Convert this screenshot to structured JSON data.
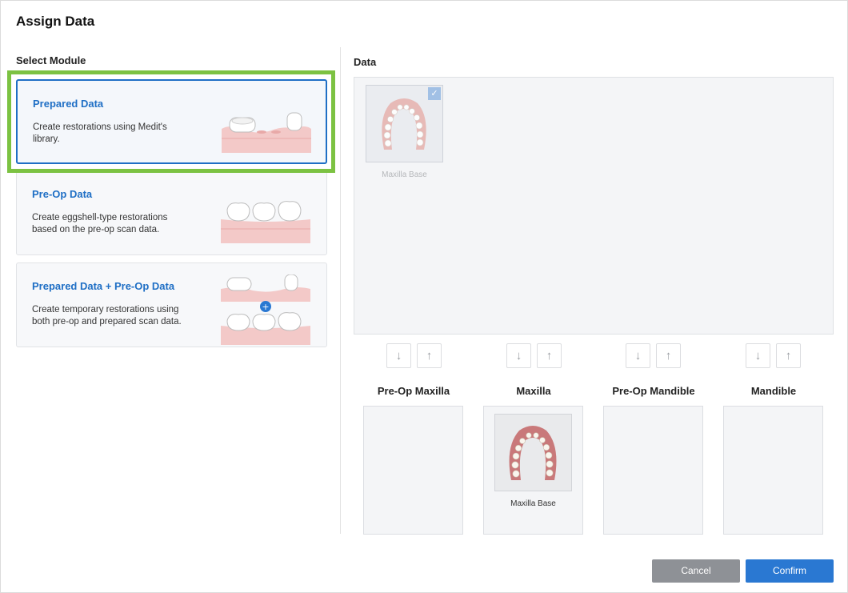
{
  "dialog": {
    "title": "Assign Data"
  },
  "left": {
    "section_title": "Select Module",
    "modules": [
      {
        "title": "Prepared Data",
        "desc": "Create restorations using Medit's library.",
        "selected": true
      },
      {
        "title": "Pre-Op Data",
        "desc": "Create eggshell-type restorations based on the pre-op scan data.",
        "selected": false
      },
      {
        "title": "Prepared Data + Pre-Op Data",
        "desc": "Create temporary restorations using both pre-op and prepared scan data.",
        "selected": false
      }
    ]
  },
  "right": {
    "section_title": "Data",
    "items": [
      {
        "label": "Maxilla Base",
        "checked": true
      }
    ],
    "slots": [
      {
        "title": "Pre-Op Maxilla",
        "item": ""
      },
      {
        "title": "Maxilla",
        "item": "Maxilla Base"
      },
      {
        "title": "Pre-Op Mandible",
        "item": ""
      },
      {
        "title": "Mandible",
        "item": ""
      }
    ]
  },
  "icons": {
    "down": "arrow-down-icon",
    "up": "arrow-up-icon",
    "check": "checkmark-icon",
    "plus": "plus-icon"
  },
  "footer": {
    "cancel_label": "Cancel",
    "confirm_label": "Confirm"
  },
  "colors": {
    "accent": "#1f6fc5",
    "highlight": "#7cc242",
    "confirm": "#2a78d2",
    "cancel": "#8e9196"
  }
}
